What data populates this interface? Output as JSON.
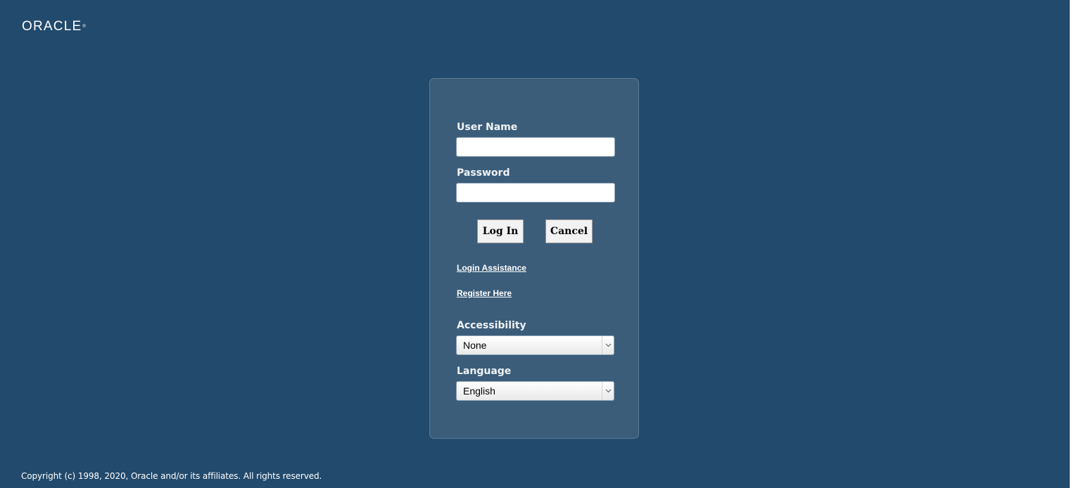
{
  "brand": {
    "logo_text": "ORACLE",
    "logo_mark": "®"
  },
  "login": {
    "username_label": "User Name",
    "username_value": "",
    "password_label": "Password",
    "password_value": "",
    "login_button": "Log In",
    "cancel_button": "Cancel",
    "login_assistance_link": "Login Assistance",
    "register_link": "Register Here",
    "accessibility_label": "Accessibility",
    "accessibility_selected": "None",
    "language_label": "Language",
    "language_selected": "English"
  },
  "footer": {
    "copyright": "Copyright (c) 1998, 2020, Oracle and/or its affiliates. All rights reserved."
  },
  "colors": {
    "background": "#224a6c",
    "panel": "#3b5d7a"
  },
  "icons": {
    "select_arrow": "chevron-down-icon"
  }
}
